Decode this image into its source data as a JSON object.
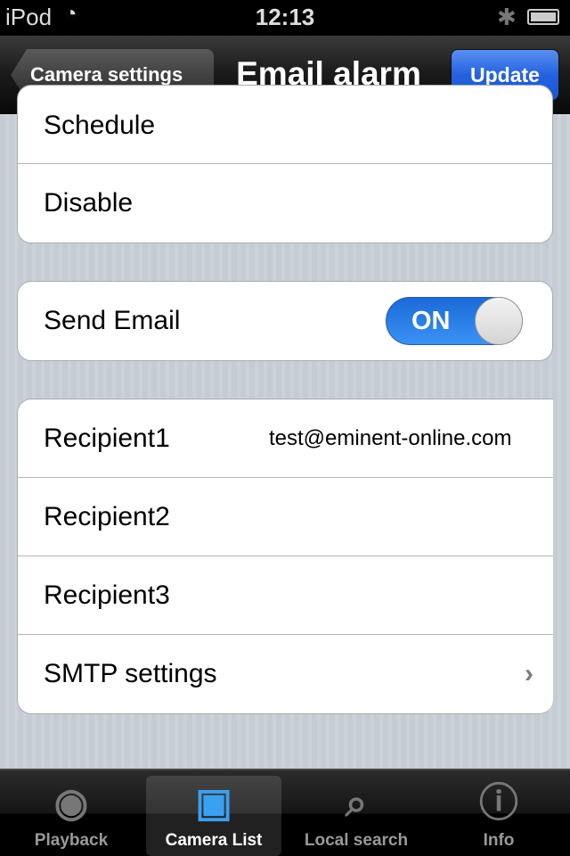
{
  "status": {
    "carrier": "iPod",
    "time": "12:13"
  },
  "nav": {
    "back": "Camera settings",
    "title": "Email alarm",
    "update": "Update"
  },
  "group1": {
    "rows": [
      "Schedule",
      "Disable"
    ]
  },
  "send_email": {
    "label": "Send Email",
    "toggle": "ON",
    "on": true
  },
  "recipients": [
    {
      "label": "Recipient1",
      "value": "test@eminent-online.com"
    },
    {
      "label": "Recipient2",
      "value": ""
    },
    {
      "label": "Recipient3",
      "value": ""
    }
  ],
  "smtp": {
    "label": "SMTP settings"
  },
  "tabs": [
    {
      "label": "Playback",
      "icon": "playback-icon"
    },
    {
      "label": "Camera List",
      "icon": "camera-list-icon",
      "selected": true
    },
    {
      "label": "Local search",
      "icon": "search-icon"
    },
    {
      "label": "Info",
      "icon": "info-icon"
    }
  ],
  "colors": {
    "accent": "#2462e0",
    "toggle": "#1a6ad8"
  }
}
